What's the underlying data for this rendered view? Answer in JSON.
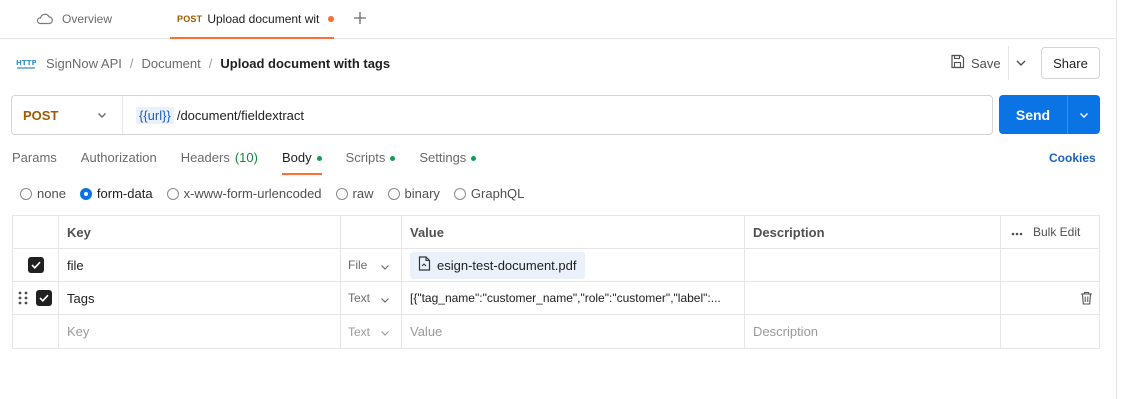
{
  "tabs": {
    "overview_label": "Overview",
    "active": {
      "method": "POST",
      "name": "Upload document with tags",
      "unsaved": true
    }
  },
  "breadcrumb": {
    "items": [
      "SignNow API",
      "Document"
    ],
    "current": "Upload document with tags"
  },
  "toolbar": {
    "save_label": "Save",
    "share_label": "Share"
  },
  "request": {
    "method": "POST",
    "url_var": "{{url}}",
    "url_path": "/document/fieldextract",
    "send_label": "Send"
  },
  "request_tabs": [
    {
      "label": "Params"
    },
    {
      "label": "Authorization"
    },
    {
      "label": "Headers",
      "count": "(10)"
    },
    {
      "label": "Body",
      "dot": true,
      "active": true
    },
    {
      "label": "Scripts",
      "dot": true
    },
    {
      "label": "Settings",
      "dot": true
    }
  ],
  "cookies_label": "Cookies",
  "body_types": [
    {
      "label": "none",
      "selected": false
    },
    {
      "label": "form-data",
      "selected": true
    },
    {
      "label": "x-www-form-urlencoded",
      "selected": false
    },
    {
      "label": "raw",
      "selected": false
    },
    {
      "label": "binary",
      "selected": false
    },
    {
      "label": "GraphQL",
      "selected": false
    }
  ],
  "table": {
    "headers": {
      "key": "Key",
      "value": "Value",
      "description": "Description",
      "bulk_edit": "Bulk Edit"
    },
    "rows": [
      {
        "checked": true,
        "key": "file",
        "type": "File",
        "value": "esign-test-document.pdf",
        "description": ""
      },
      {
        "checked": true,
        "key": "Tags",
        "type": "Text",
        "value": "[{\"tag_name\":\"customer_name\",\"role\":\"customer\",\"label\":...",
        "description": ""
      }
    ],
    "empty_row": {
      "key_placeholder": "Key",
      "type": "Text",
      "value_placeholder": "Value",
      "description_placeholder": "Description"
    }
  },
  "colors": {
    "accent": "#ff6c37",
    "send": "#0b74e5",
    "method": "#a05a00",
    "link": "#1f5fbf"
  }
}
